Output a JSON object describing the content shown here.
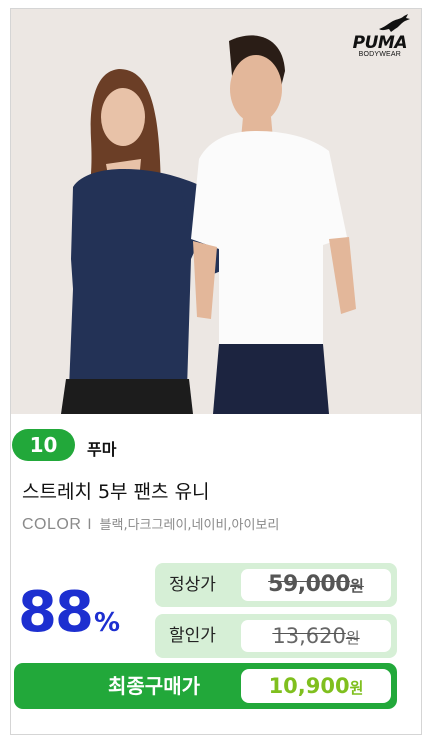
{
  "brand_logo": {
    "word": "PUMA",
    "sub": "BODYWEAR"
  },
  "rank": "10",
  "brand_name": "푸마",
  "product_name": "스트레치 5부 팬츠 유니",
  "color": {
    "label": "COLOR",
    "separator": "I",
    "options": "블랙,다크그레이,네이비,아이보리"
  },
  "discount": {
    "value": "88",
    "unit": "%"
  },
  "regular_price": {
    "label": "정상가",
    "amount": "59,000",
    "unit": "원"
  },
  "sale_price": {
    "label": "할인가",
    "amount": "13,620",
    "unit": "원"
  },
  "final_price": {
    "label": "최종구매가",
    "amount": "10,900",
    "unit": "원"
  },
  "colors": {
    "accent_green": "#22a83a",
    "light_green": "#d6efd6",
    "discount_blue": "#1d2fd0",
    "final_amount": "#7fbf1e"
  },
  "icons": [
    "puma-cat-logo-icon"
  ]
}
